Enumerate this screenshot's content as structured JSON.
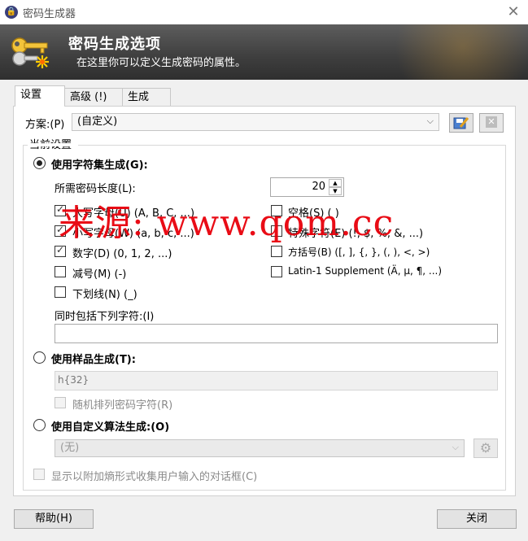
{
  "window": {
    "title": "密码生成器",
    "close_glyph": "✕"
  },
  "banner": {
    "title": "密码生成选项",
    "subtitle": "在这里你可以定义生成密码的属性。"
  },
  "tabs": [
    {
      "label": "设置"
    },
    {
      "label": "高级 (!)"
    },
    {
      "label": "生成"
    }
  ],
  "profile": {
    "label": "方案:(P)",
    "value": "(自定义)"
  },
  "current_settings": {
    "label": "当前设置"
  },
  "charset": {
    "radio_label": "使用字符集生成(G):",
    "length_label": "所需密码长度(L):",
    "length_value": "20",
    "options": [
      {
        "label": "大写字母(U) (A, B, C, ...)",
        "checked": true
      },
      {
        "label": "小写字母(W) (a, b, c, ...)",
        "checked": true
      },
      {
        "label": "数字(D) (0, 1, 2, ...)",
        "checked": true
      },
      {
        "label": "减号(M) (-)",
        "checked": false
      },
      {
        "label": "下划线(N) (_)",
        "checked": false
      },
      {
        "label": "空格(S) ( )",
        "checked": false
      },
      {
        "label": "特殊字符(E) (!, $, %, &, ...)",
        "checked": false
      },
      {
        "label": "方括号(B) ([, ], {, }, (, ), <, >)",
        "checked": false
      },
      {
        "label": "Latin-1 Supplement (Ä, µ, ¶, ...)",
        "checked": false
      }
    ],
    "include_label": "同时包括下列字符:(I)",
    "include_value": ""
  },
  "pattern": {
    "radio_label": "使用样品生成(T):",
    "value": "h{32}",
    "permute_label": "随机排列密码字符(R)"
  },
  "custom": {
    "radio_label": "使用自定义算法生成:(O)",
    "value": "(无)"
  },
  "entropy": {
    "label": "显示以附加熵形式收集用户输入的对话框(C)"
  },
  "buttons": {
    "help": "帮助(H)",
    "close": "关闭"
  },
  "watermark": "来源: www.qom.cc",
  "colors": {
    "watermark": "#e8000a",
    "banner": "#3e3e3e"
  }
}
